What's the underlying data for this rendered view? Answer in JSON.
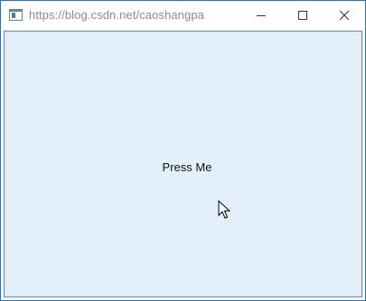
{
  "window": {
    "title": "https://blog.csdn.net/caoshangpa",
    "icon": "app-window-icon"
  },
  "controls": {
    "minimize_icon": "minimize-icon",
    "maximize_icon": "maximize-icon",
    "close_icon": "close-icon"
  },
  "content": {
    "button_label": "Press Me",
    "background_color": "#e3f0fc"
  },
  "pointer": {
    "icon": "mouse-cursor-icon"
  }
}
